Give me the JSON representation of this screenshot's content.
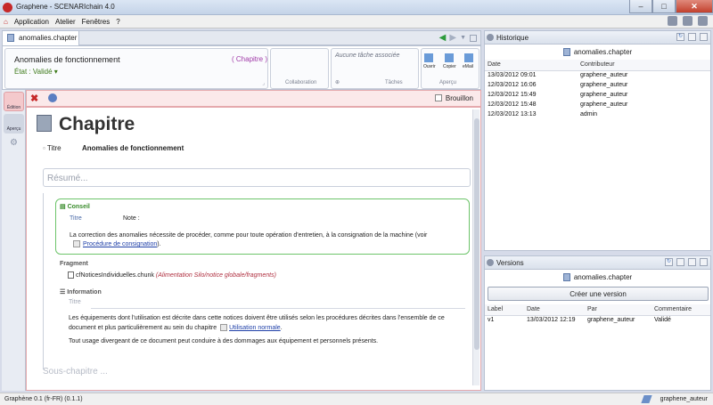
{
  "window": {
    "title": "Graphene - SCENARIchain 4.0",
    "min": "–",
    "max": "□",
    "close": "✕"
  },
  "menu": {
    "application": "Application",
    "atelier": "Atelier",
    "fenetres": "Fenêtres",
    "help": "?"
  },
  "editor_tab": {
    "label": "anomalies.chapter"
  },
  "header": {
    "doc_title": "Anomalies de fonctionnement",
    "type_badge": "( Chapitre )",
    "etat": "État : Validé",
    "collaboration": "Collaboration",
    "task_placeholder": "Aucune tâche associée",
    "taches": "Tâches",
    "ouvrir": "Ouvrir",
    "copier": "Copier",
    "email": "eMail",
    "apercu": "Aperçu"
  },
  "left_strip": {
    "edition": "Édition",
    "apercu": "Aperçu"
  },
  "toolbar": {
    "brouillon": "Brouillon"
  },
  "document": {
    "heading": "Chapitre",
    "titre_label": "Titre",
    "titre_value": "Anomalies de fonctionnement",
    "resume_placeholder": "Résumé...",
    "conseil": {
      "header": "Conseil",
      "titre_label": "Titre",
      "note": "Note :",
      "body_text": "La correction des anomalies nécessite de procéder, comme pour toute opération d'entretien, à la consignation de la machine (voir",
      "link": "Procédure de consignation",
      "body_end": ")."
    },
    "fragment": {
      "label": "Fragment",
      "file": "cfNoticesIndividuelles.chunk",
      "path": "(Alimentation Silo/notice globale/fragments)"
    },
    "information": {
      "label": "Information",
      "titre_placeholder": "Titre",
      "p1": "Les équipements dont l'utilisation est décrite dans cette notices doivent être utilisés selon les procédures décrites dans l'ensemble de ce document et plus particulièrement au sein du chapitre",
      "p1_link": "Utilisation normale",
      "p1_end": ".",
      "p2": "Tout usage divergeant de ce document peut conduire à des dommages aux équipement et personnels présents."
    },
    "sous_chapitre_placeholder": "Sous-chapitre ..."
  },
  "historique": {
    "title": "Historique",
    "doc": "anomalies.chapter",
    "col_date": "Date",
    "col_contrib": "Contributeur",
    "rows": [
      {
        "date": "13/03/2012 09:01",
        "contrib": "graphene_auteur"
      },
      {
        "date": "12/03/2012 16:06",
        "contrib": "graphene_auteur"
      },
      {
        "date": "12/03/2012 15:49",
        "contrib": "graphene_auteur"
      },
      {
        "date": "12/03/2012 15:48",
        "contrib": "graphene_auteur"
      },
      {
        "date": "12/03/2012 13:13",
        "contrib": "admin"
      }
    ]
  },
  "versions": {
    "title": "Versions",
    "doc": "anomalies.chapter",
    "create_button": "Créer une version",
    "col_label": "Label",
    "col_date": "Date",
    "col_par": "Par",
    "col_commentaire": "Commentaire",
    "rows": [
      {
        "label": "v1",
        "date": "13/03/2012 12:19",
        "par": "graphene_auteur",
        "commentaire": "Validé"
      }
    ]
  },
  "status": {
    "left": "Graphène 0.1 (fr-FR) (0.1.1)",
    "user": "graphene_auteur"
  }
}
